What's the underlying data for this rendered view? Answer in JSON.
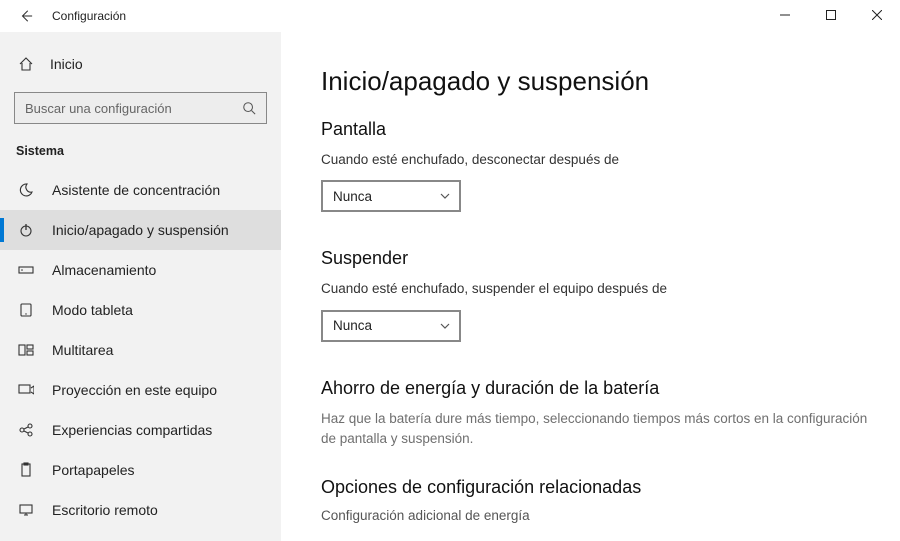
{
  "titlebar": {
    "title": "Configuración"
  },
  "sidebar": {
    "home": "Inicio",
    "search_placeholder": "Buscar una configuración",
    "category": "Sistema",
    "items": [
      {
        "label": "Asistente de concentración"
      },
      {
        "label": "Inicio/apagado y suspensión"
      },
      {
        "label": "Almacenamiento"
      },
      {
        "label": "Modo tableta"
      },
      {
        "label": "Multitarea"
      },
      {
        "label": "Proyección en este equipo"
      },
      {
        "label": "Experiencias compartidas"
      },
      {
        "label": "Portapapeles"
      },
      {
        "label": "Escritorio remoto"
      }
    ]
  },
  "main": {
    "page_title": "Inicio/apagado y suspensión",
    "screen": {
      "heading": "Pantalla",
      "label": "Cuando esté enchufado, desconectar después de",
      "value": "Nunca"
    },
    "sleep": {
      "heading": "Suspender",
      "label": "Cuando esté enchufado, suspender el equipo después de",
      "value": "Nunca"
    },
    "battery": {
      "heading": "Ahorro de energía y duración de la batería",
      "text": "Haz que la batería dure más tiempo, seleccionando tiempos más cortos en la configuración de pantalla y suspensión."
    },
    "related": {
      "heading": "Opciones de configuración relacionadas",
      "link": "Configuración adicional de energía"
    }
  }
}
